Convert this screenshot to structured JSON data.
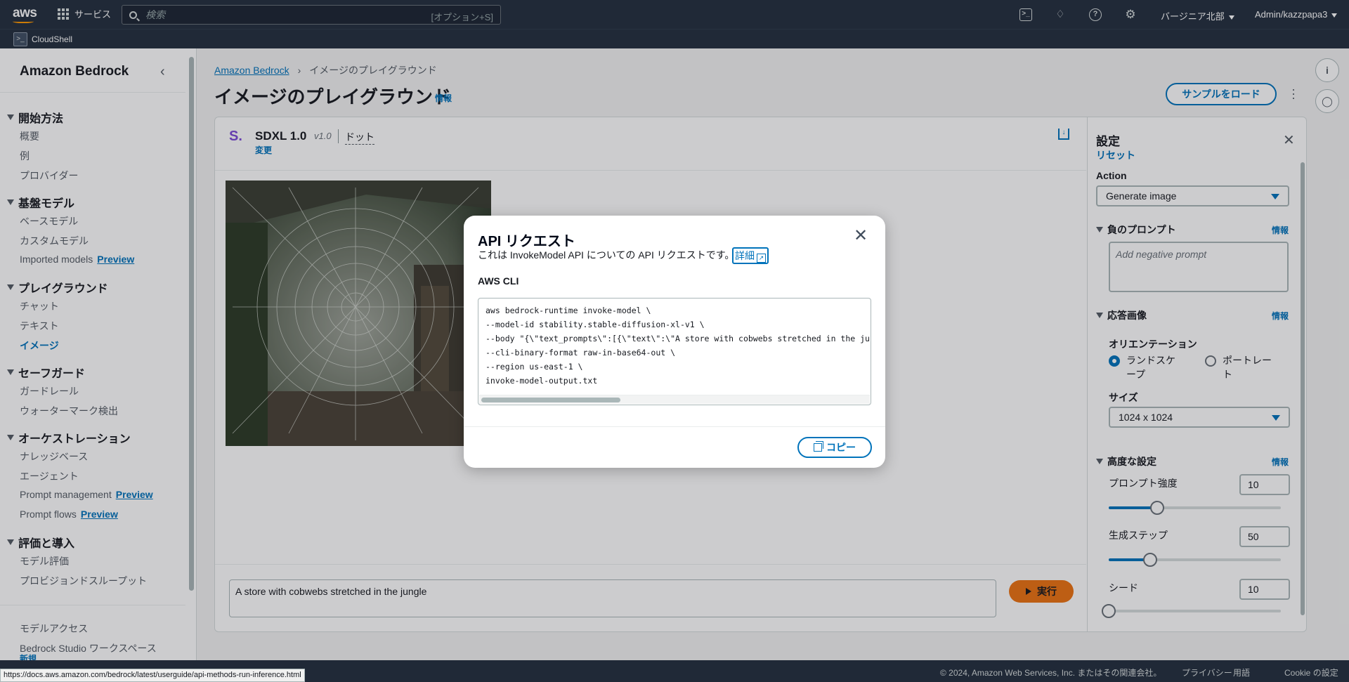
{
  "topnav": {
    "logo": "aws",
    "services_label": "サービス",
    "search_placeholder": "検索",
    "search_shortcut": "[オプション+S]",
    "region": "バージニア北部",
    "account": "Admin/kazzpapa3",
    "icons": [
      "cloudshell-icon",
      "bell-icon",
      "help-icon",
      "gear-icon"
    ]
  },
  "subbar": {
    "cloudshell_label": "CloudShell"
  },
  "sidebar": {
    "title": "Amazon Bedrock",
    "sections": [
      {
        "label": "開始方法",
        "items": [
          "概要",
          "例",
          "プロバイダー"
        ]
      },
      {
        "label": "基盤モデル",
        "items": [
          "ベースモデル",
          "カスタムモデル",
          "Imported models"
        ]
      },
      {
        "label": "プレイグラウンド",
        "items": [
          "チャット",
          "テキスト",
          "イメージ"
        ]
      },
      {
        "label": "セーフガード",
        "items": [
          "ガードレール",
          "ウォーターマーク検出"
        ]
      },
      {
        "label": "オーケストレーション",
        "items": [
          "ナレッジベース",
          "エージェント",
          "Prompt management",
          "Prompt flows"
        ]
      },
      {
        "label": "評価と導入",
        "items": [
          "モデル評価",
          "プロビジョンドスループット"
        ]
      }
    ],
    "preview_badge": "Preview",
    "bottom_items": [
      "モデルアクセス",
      "Bedrock Studio ワークスペース"
    ],
    "new_badge": "新規"
  },
  "breadcrumb": {
    "root": "Amazon Bedrock",
    "current": "イメージのプレイグラウンド"
  },
  "page": {
    "title": "イメージのプレイグラウンド",
    "info": "情報",
    "load_sample": "サンプルをロード"
  },
  "model": {
    "logo": "S.",
    "name": "SDXL 1.0",
    "version": "v1.0",
    "provider": "ドット",
    "change": "変更"
  },
  "prompt": {
    "value": "A store with cobwebs stretched in the jungle",
    "run_label": "実行"
  },
  "settings": {
    "title": "設定",
    "reset": "リセット",
    "action_label": "Action",
    "action_value": "Generate image",
    "negative_prompt_label": "負のプロンプト",
    "negative_prompt_placeholder": "Add negative prompt",
    "info": "情報",
    "response_image_label": "応答画像",
    "orientation_label": "オリエンテーション",
    "landscape": "ランドスケープ",
    "portrait": "ポートレート",
    "size_label": "サイズ",
    "size_value": "1024 x 1024",
    "advanced_label": "高度な設定",
    "prompt_strength_label": "プロンプト強度",
    "prompt_strength_value": "10",
    "prompt_strength_fraction": 0.28,
    "steps_label": "生成ステップ",
    "steps_value": "50",
    "steps_fraction": 0.24,
    "seed_label": "シード",
    "seed_value": "10",
    "seed_fraction": 0.0
  },
  "modal": {
    "title": "API リクエスト",
    "description": "これは InvokeModel API についての API リクエストです。",
    "detail_link": "詳細",
    "subtitle": "AWS CLI",
    "code_lines": [
      "aws bedrock-runtime invoke-model \\",
      "--model-id stability.stable-diffusion-xl-v1 \\",
      "--body \"{\\\"text_prompts\\\":[{\\\"text\\\":\\\"A store with cobwebs stretched in the ju",
      "--cli-binary-format raw-in-base64-out \\",
      "--region us-east-1 \\",
      "invoke-model-output.txt"
    ],
    "copy_label": "コピー"
  },
  "footer": {
    "copyright": "© 2024, Amazon Web Services, Inc. またはその関連会社。",
    "privacy": "プライバシー",
    "terms": "用語",
    "cookie": "Cookie の設定"
  },
  "status_url": "https://docs.aws.amazon.com/bedrock/latest/userguide/api-methods-run-inference.html",
  "colors": {
    "nav": "#232f3e",
    "link": "#0073bb",
    "primary": "#ec7211"
  }
}
